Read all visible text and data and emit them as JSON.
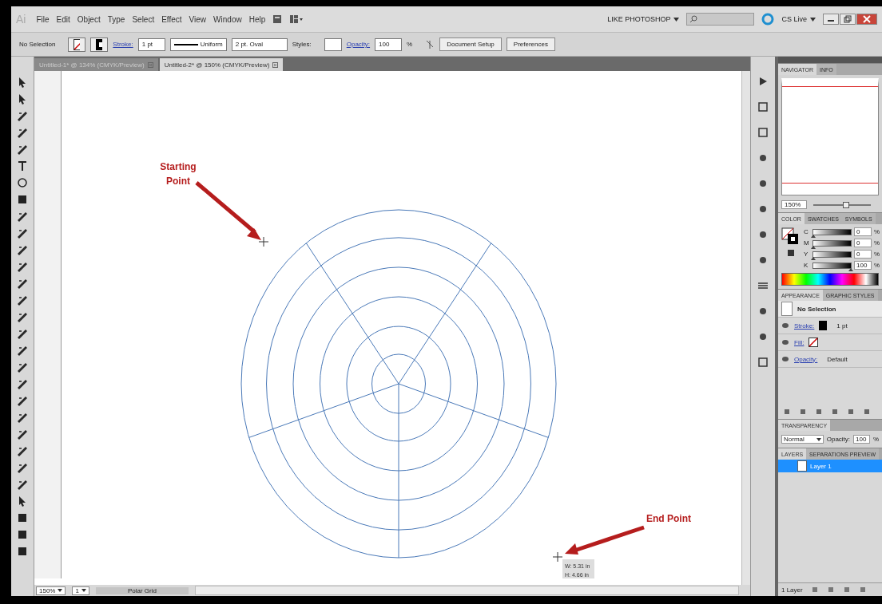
{
  "app": {
    "logo": "Ai",
    "menu": [
      "File",
      "Edit",
      "Object",
      "Type",
      "Select",
      "Effect",
      "View",
      "Window",
      "Help"
    ],
    "workspace": "LIKE PHOTOSHOP",
    "cs_live": "CS Live"
  },
  "control_bar": {
    "selection": "No Selection",
    "stroke_label": "Stroke:",
    "stroke_weight": "1 pt",
    "profile": "Uniform",
    "brush": "2 pt. Oval",
    "styles_label": "Styles:",
    "opacity_label": "Opacity:",
    "opacity": "100",
    "percent": "%",
    "buttons": [
      "Document Setup",
      "Preferences"
    ]
  },
  "doc_tabs": [
    {
      "label": "Untitled-1* @ 134% (CMYK/Preview)",
      "selected": false
    },
    {
      "label": "Untitled-2* @ 150% (CMYK/Preview)",
      "selected": true
    }
  ],
  "canvas": {
    "start_label": [
      "Starting",
      "Point"
    ],
    "end_label": "End Point",
    "tooltip": [
      "W: 5.31 in",
      "H: 4.66 in"
    ]
  },
  "status_bar": {
    "zoom": "150%",
    "page": "1",
    "tool": "Polar Grid"
  },
  "navigator": {
    "tabs": [
      {
        "label": "NAVIGATOR",
        "selected": true
      },
      {
        "label": "INFO",
        "selected": false
      }
    ],
    "zoom": "150%",
    "level": 0.55
  },
  "color": {
    "tabs": [
      {
        "label": "COLOR",
        "selected": true
      },
      {
        "label": "SWATCHES",
        "selected": false
      },
      {
        "label": "SYMBOLS",
        "selected": false
      }
    ],
    "channels": [
      {
        "name": "C",
        "value": "0",
        "unit": "%",
        "level": 0
      },
      {
        "name": "M",
        "value": "0",
        "unit": "%",
        "level": 0
      },
      {
        "name": "Y",
        "value": "0",
        "unit": "%",
        "level": 0
      },
      {
        "name": "K",
        "value": "100",
        "unit": "%",
        "level": 1
      }
    ]
  },
  "appearance": {
    "tabs": [
      {
        "label": "APPEARANCE",
        "selected": true
      },
      {
        "label": "GRAPHIC STYLES",
        "selected": false
      }
    ],
    "title": "No Selection",
    "rows": [
      {
        "kind": "stroke",
        "label": "Stroke:",
        "value": "1 pt"
      },
      {
        "kind": "fill",
        "label": "Fill:"
      },
      {
        "kind": "opacity",
        "label": "Opacity:",
        "value": "Default"
      }
    ]
  },
  "transparency": {
    "title": "TRANSPARENCY",
    "blend": "Normal",
    "opacity_label": "Opacity:",
    "opacity": "100",
    "percent": "%"
  },
  "layers": {
    "tabs": [
      {
        "label": "LAYERS",
        "selected": true
      },
      {
        "label": "SEPARATIONS PREVIEW",
        "selected": false
      }
    ],
    "items": [
      {
        "name": "Layer 1",
        "selected": true
      }
    ],
    "count": "1 Layer"
  }
}
